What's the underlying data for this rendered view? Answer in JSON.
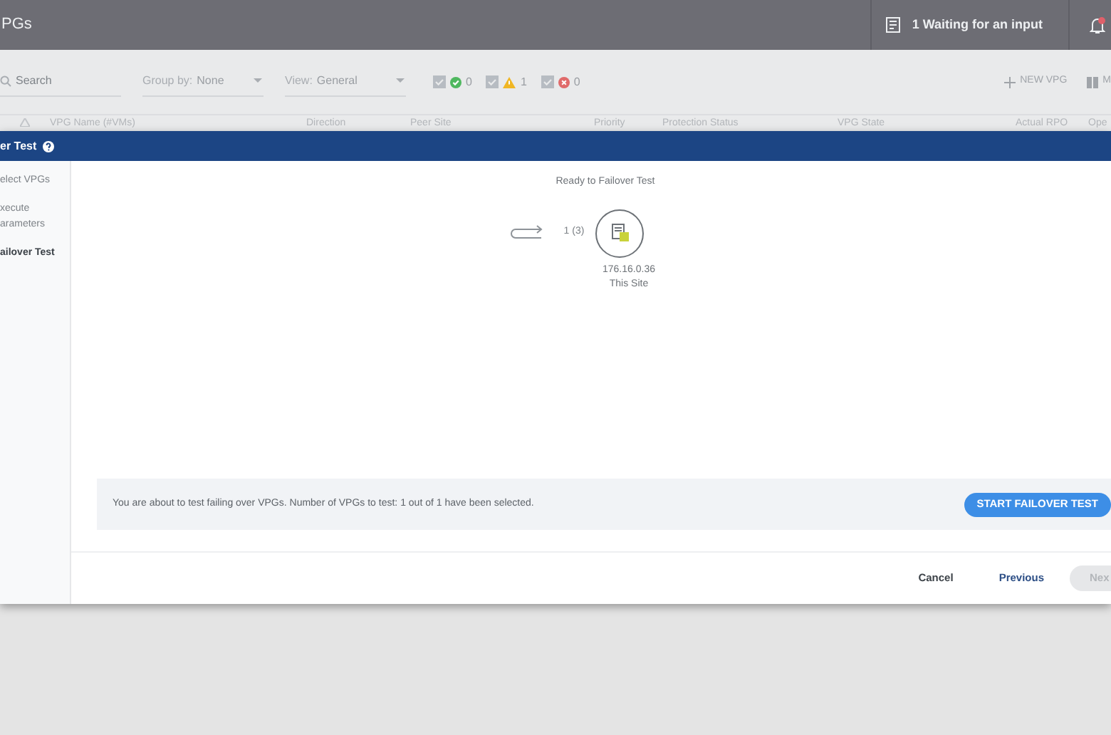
{
  "top_bar": {
    "title": "PGs",
    "tasks": "1 Waiting for an input",
    "notification_badge": true
  },
  "toolbar": {
    "search": {
      "placeholder": "Search"
    },
    "group_by": {
      "label": "Group by:",
      "value": "None"
    },
    "view": {
      "label": "View:",
      "value": "General"
    },
    "filters": [
      {
        "kind": "ok",
        "count": "0",
        "checked": true
      },
      {
        "kind": "warning",
        "count": "1",
        "checked": true
      },
      {
        "kind": "error",
        "count": "0",
        "checked": true
      }
    ],
    "actions": [
      {
        "kind": "plus",
        "label": "NEW VPG"
      },
      {
        "kind": "columns",
        "label": "M"
      }
    ]
  },
  "table": {
    "columns": [
      "VPG Name (#VMs)",
      "Direction",
      "Peer Site",
      "Priority",
      "Protection Status",
      "VPG State",
      "Actual RPO",
      "Ope"
    ]
  },
  "wizard": {
    "title": "er Test",
    "steps": [
      {
        "lines": [
          "elect VPGs"
        ],
        "selected": false
      },
      {
        "lines": [
          "xecute",
          "arameters"
        ],
        "selected": false
      },
      {
        "lines": [
          "ailover Test"
        ],
        "selected": true
      }
    ],
    "status": "Ready to Failover Test",
    "count": "1 (3)",
    "site_ip": "176.16.0.36",
    "site_name": "This Site",
    "info": "You are about to test failing over VPGs. Number of VPGs to test: 1 out of 1 have been selected.",
    "start_button": "START FAILOVER TEST",
    "buttons": [
      {
        "label": "Cancel",
        "disabled": false
      },
      {
        "label": "Previous",
        "disabled": false
      },
      {
        "label": "Nex",
        "disabled": true
      }
    ]
  }
}
